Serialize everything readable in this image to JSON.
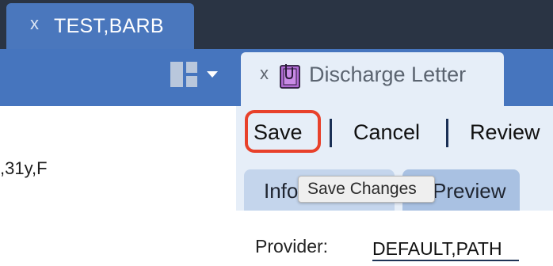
{
  "patient_tab": {
    "close": "x",
    "name": "TEST,BARB"
  },
  "left_panel": {
    "demographics": ",31y,F"
  },
  "document_tab": {
    "close": "x",
    "title": "Discharge Letter",
    "icon": "document-clip-icon"
  },
  "actions": {
    "save": "Save",
    "cancel": "Cancel",
    "review": "Review",
    "separator": "|"
  },
  "subtabs": {
    "info": "Info",
    "preview": "Preview"
  },
  "tooltip": "Save Changes",
  "form": {
    "provider_label": "Provider:",
    "provider_value": "DEFAULT,PATH"
  },
  "colors": {
    "topbar": "#2a3444",
    "band": "#4675be",
    "tab_active": "#4a77bd",
    "highlight": "#e8412b",
    "panel": "#e6eef8"
  }
}
